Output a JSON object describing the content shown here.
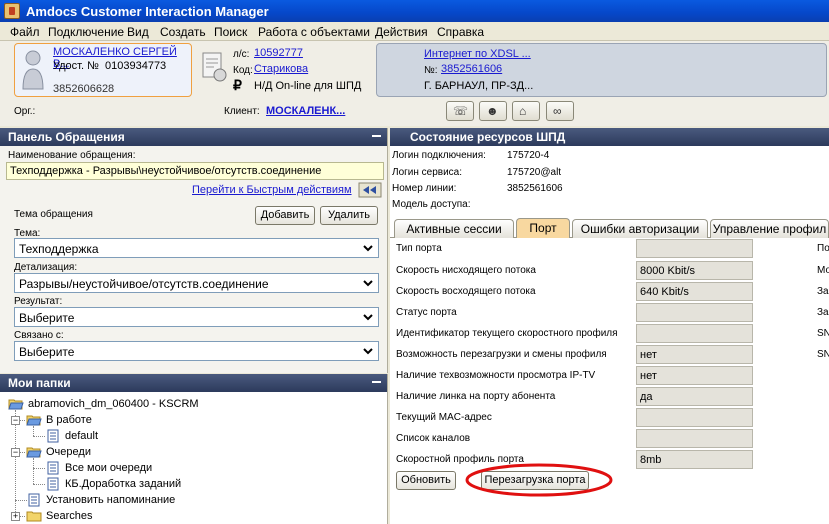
{
  "window": {
    "title": "Amdocs Customer Interaction Manager"
  },
  "menu": [
    "Файл",
    "Подключение",
    "Вид",
    "Создать",
    "Поиск",
    "Работа с объектами",
    "Действия",
    "Справка"
  ],
  "customer": {
    "name": "МОСКАЛЕНКО СЕРГЕЙ В...",
    "id_label": "Удост. №",
    "id_value": "0103934773",
    "phone": "3852606628"
  },
  "account": {
    "ls_label": "л/с:",
    "ls_value": "10592777",
    "code_label": "Код:",
    "code_value": "Старикова",
    "tariff": "Н/Д On-line для ШПД"
  },
  "service": {
    "name": "Интернет по XDSL ...",
    "num_label": "№:",
    "num_value": "3852561606",
    "address": "Г. БАРНАУЛ, ПР-ЗД..."
  },
  "org_label": "Орг.:",
  "client_label": "Клиент:",
  "client_value": "МОСКАЛЕНК...",
  "left_panel": {
    "title": "Панель Обращения",
    "name_label": "Наименование обращения:",
    "name_value": "Техподдержка - Разрывы\\неустойчивое/отсутств.соединение",
    "quick_link": "Перейти к Быстрым действиям",
    "topic_label": "Тема обращения",
    "add_button": "Добавить",
    "remove_button": "Удалить",
    "theme_label": "Тема:",
    "theme_value": "Техподдержка",
    "detail_label": "Детализация:",
    "detail_value": "Разрывы/неустойчивое/отсутств.соединение",
    "result_label": "Результат:",
    "result_value": "Выберите",
    "related_label": "Связано с:",
    "related_value": "Выберите"
  },
  "folders": {
    "title": "Мои папки",
    "root": "abramovich_dm_060400 - KSCRM",
    "in_work": "В работе",
    "default": "default",
    "queues": "Очереди",
    "all_queues": "Все мои очереди",
    "kb": "КБ.Доработка заданий",
    "reminder": "Установить напоминание",
    "searches": "Searches"
  },
  "resources": {
    "title": "Состояние ресурсов ШПД",
    "rows": [
      {
        "label": "Логин подключения:",
        "value": "175720-4"
      },
      {
        "label": "Логин сервиса:",
        "value": "175720@alt"
      },
      {
        "label": "Номер линии:",
        "value": "3852561606"
      },
      {
        "label": "Модель доступа:",
        "value": ""
      }
    ]
  },
  "tabs": [
    "Активные сессии",
    "Порт",
    "Ошибки авторизации",
    "Управление профил"
  ],
  "port": {
    "fields": [
      {
        "label": "Тип порта",
        "value": ""
      },
      {
        "label": "Скорость нисходящего потока",
        "value": "8000 Kbit/s"
      },
      {
        "label": "Скорость восходящего потока",
        "value": "640 Kbit/s"
      },
      {
        "label": "Статус порта",
        "value": ""
      },
      {
        "label": "Идентификатор текущего скоростного профиля",
        "value": ""
      },
      {
        "label": "Возможность перезагрузки и смены профиля",
        "value": "нет"
      },
      {
        "label": "Наличие техвозможности просмотра IP-TV",
        "value": "нет"
      },
      {
        "label": "Наличие линка на порту абонента",
        "value": "да"
      },
      {
        "label": "Текущий MAC-адрес",
        "value": ""
      },
      {
        "label": "Список каналов",
        "value": ""
      },
      {
        "label": "Скоростной профиль порта",
        "value": "8mb"
      }
    ],
    "right_labels": [
      "По",
      "Мо",
      "За",
      "За",
      "SN",
      "SN"
    ],
    "refresh_button": "Обновить",
    "reboot_button": "Перезагрузка порта"
  },
  "colors": {
    "highlight_ring": "#e01010",
    "header": "#2c3a5c",
    "active_tab": "#f8d8a0"
  }
}
